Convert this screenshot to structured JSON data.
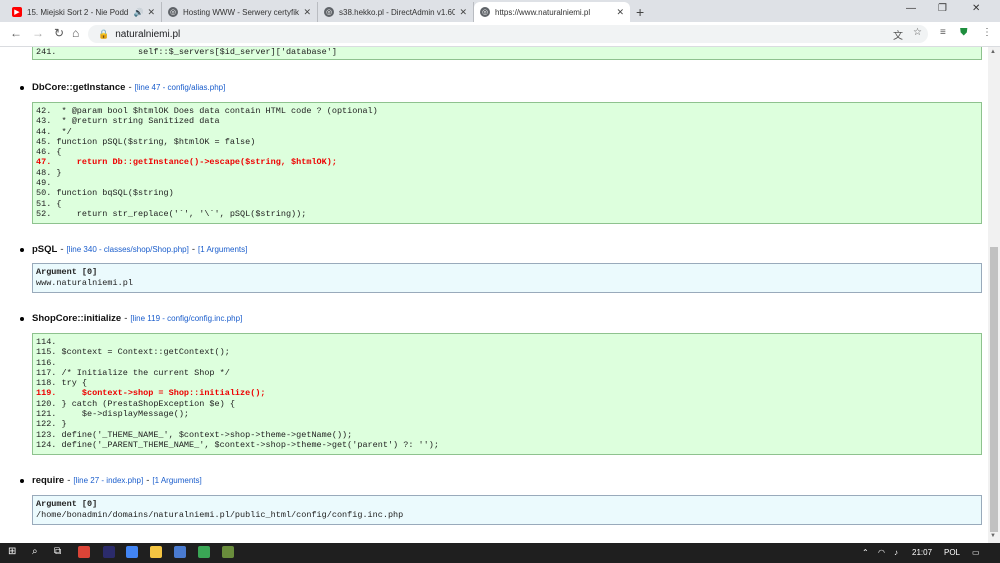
{
  "browser": {
    "tabs": [
      {
        "title": "15. Miejski Sort 2 - Nie Podd",
        "icon": "youtube-icon",
        "color": "#ff0000"
      },
      {
        "title": "Hosting WWW - Serwery certyfik",
        "icon": "globe-icon",
        "color": "#5f6368"
      },
      {
        "title": "s38.hekko.pl - DirectAdmin v1.60",
        "icon": "globe-icon",
        "color": "#5f6368"
      },
      {
        "title": "https://www.naturalniemi.pl",
        "icon": "globe-icon",
        "color": "#5f6368"
      }
    ],
    "new_tab": "+",
    "url": "naturalniemi.pl"
  },
  "trace": {
    "top_line": "241.                self::$_servers[$id_server]['database']",
    "frames": [
      {
        "fn": "DbCore::getInstance",
        "location": "[line 47 - config/alias.php]",
        "code": [
          {
            "t": "42.  * @param bool $htmlOK Does data contain HTML code ? (optional)"
          },
          {
            "t": "43.  * @return string Sanitized data"
          },
          {
            "t": "44.  */"
          },
          {
            "t": "45. function pSQL($string, $htmlOK = false)"
          },
          {
            "t": "46. {"
          },
          {
            "t": "47.     return Db::getInstance()->escape($string, $htmlOK);",
            "hl": true
          },
          {
            "t": "48. }"
          },
          {
            "t": "49."
          },
          {
            "t": "50. function bqSQL($string)"
          },
          {
            "t": "51. {"
          },
          {
            "t": "52.     return str_replace('`', '\\`', pSQL($string));"
          }
        ]
      },
      {
        "fn": "pSQL",
        "location": "[line 340 - classes/shop/Shop.php]",
        "arguments_link": "[1 Arguments]",
        "arg_header": "Argument [0]",
        "arg_value": "www.naturalniemi.pl"
      },
      {
        "fn": "ShopCore::initialize",
        "location": "[line 119 - config/config.inc.php]",
        "code": [
          {
            "t": "114."
          },
          {
            "t": "115. $context = Context::getContext();"
          },
          {
            "t": "116."
          },
          {
            "t": "117. /* Initialize the current Shop */"
          },
          {
            "t": "118. try {"
          },
          {
            "t": "119.     $context->shop = Shop::initialize();",
            "hl": true
          },
          {
            "t": "120. } catch (PrestaShopException $e) {"
          },
          {
            "t": "121.     $e->displayMessage();"
          },
          {
            "t": "122. }"
          },
          {
            "t": "123. define('_THEME_NAME_', $context->shop->theme->getName());"
          },
          {
            "t": "124. define('_PARENT_THEME_NAME_', $context->shop->theme->get('parent') ?: '');"
          }
        ]
      },
      {
        "fn": "require",
        "location": "[line 27 - index.php]",
        "arguments_link": "[1 Arguments]",
        "arg_header": "Argument [0]",
        "arg_value": "/home/bonadmin/domains/naturalniemi.pl/public_html/config/config.inc.php"
      }
    ]
  },
  "taskbar": {
    "clock": "21:07",
    "lang": "POL"
  }
}
